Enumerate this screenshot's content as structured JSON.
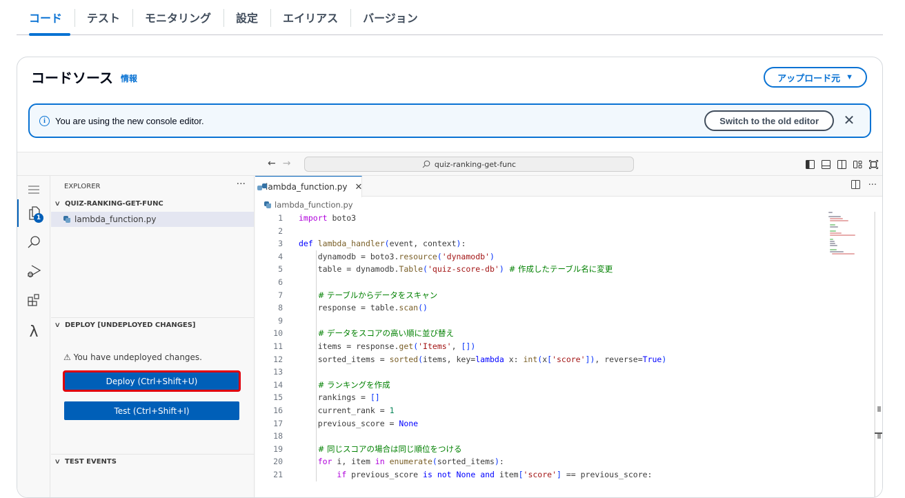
{
  "top_tabs": [
    {
      "label": "コード",
      "active": true
    },
    {
      "label": "テスト",
      "active": false
    },
    {
      "label": "モニタリング",
      "active": false
    },
    {
      "label": "設定",
      "active": false
    },
    {
      "label": "エイリアス",
      "active": false
    },
    {
      "label": "バージョン",
      "active": false
    }
  ],
  "card": {
    "title": "コードソース",
    "info_link": "情報",
    "upload_button": "アップロード元",
    "upload_caret": "▼"
  },
  "flash": {
    "icon": "info-icon",
    "message": "You are using the new console editor.",
    "switch_button": "Switch to the old editor",
    "close_glyph": "✕"
  },
  "ide": {
    "nav_back": "←",
    "nav_forward": "→",
    "command_center": "quiz-ranking-get-func",
    "layout_icons": [
      "toggle-primary-sidebar-icon",
      "toggle-panel-icon",
      "toggle-secondary-sidebar-icon",
      "customize-layout-icon",
      "fullscreen-icon"
    ],
    "activity_bar": [
      {
        "name": "menu-icon",
        "glyph": "≡"
      },
      {
        "name": "explorer-icon",
        "badge": "1"
      },
      {
        "name": "search-icon"
      },
      {
        "name": "run-debug-icon"
      },
      {
        "name": "extensions-icon"
      },
      {
        "name": "lambda-icon",
        "glyph": "λ"
      }
    ],
    "explorer": {
      "header": "EXPLORER",
      "more": "···",
      "folder": "QUIZ-RANKING-GET-FUNC",
      "files": [
        "lambda_function.py"
      ]
    },
    "deploy_section": {
      "title": "DEPLOY [UNDEPLOYED CHANGES]",
      "warning_icon": "⚠",
      "warning": "You have undeployed changes.",
      "deploy_button": "Deploy (Ctrl+Shift+U)",
      "test_button": "Test (Ctrl+Shift+I)"
    },
    "test_events_section": {
      "title": "TEST EVENTS"
    },
    "editor": {
      "tab_label": "lambda_function.py",
      "tab_close": "✕",
      "breadcrumb": "lambda_function.py",
      "tab_actions": [
        "split-editor-icon",
        "more-actions-icon"
      ],
      "more_glyph": "···",
      "lines": [
        {
          "n": "1",
          "text": "import boto3"
        },
        {
          "n": "2",
          "text": ""
        },
        {
          "n": "3",
          "text": "def lambda_handler(event, context):"
        },
        {
          "n": "4",
          "text": "    dynamodb = boto3.resource('dynamodb')"
        },
        {
          "n": "5",
          "text": "    table = dynamodb.Table('quiz-score-db') # 作成したテーブル名に変更"
        },
        {
          "n": "6",
          "text": ""
        },
        {
          "n": "7",
          "text": "    # テーブルからデータをスキャン"
        },
        {
          "n": "8",
          "text": "    response = table.scan()"
        },
        {
          "n": "9",
          "text": ""
        },
        {
          "n": "10",
          "text": "    # データをスコアの高い順に並び替え"
        },
        {
          "n": "11",
          "text": "    items = response.get('Items', [])"
        },
        {
          "n": "12",
          "text": "    sorted_items = sorted(items, key=lambda x: int(x['score']), reverse=True)"
        },
        {
          "n": "13",
          "text": ""
        },
        {
          "n": "14",
          "text": "    # ランキングを作成"
        },
        {
          "n": "15",
          "text": "    rankings = []"
        },
        {
          "n": "16",
          "text": "    current_rank = 1"
        },
        {
          "n": "17",
          "text": "    previous_score = None"
        },
        {
          "n": "18",
          "text": ""
        },
        {
          "n": "19",
          "text": "    # 同じスコアの場合は同じ順位をつける"
        },
        {
          "n": "20",
          "text": "    for i, item in enumerate(sorted_items):"
        },
        {
          "n": "21",
          "text": "        if previous_score is not None and item['score'] == previous_score:"
        }
      ]
    }
  }
}
